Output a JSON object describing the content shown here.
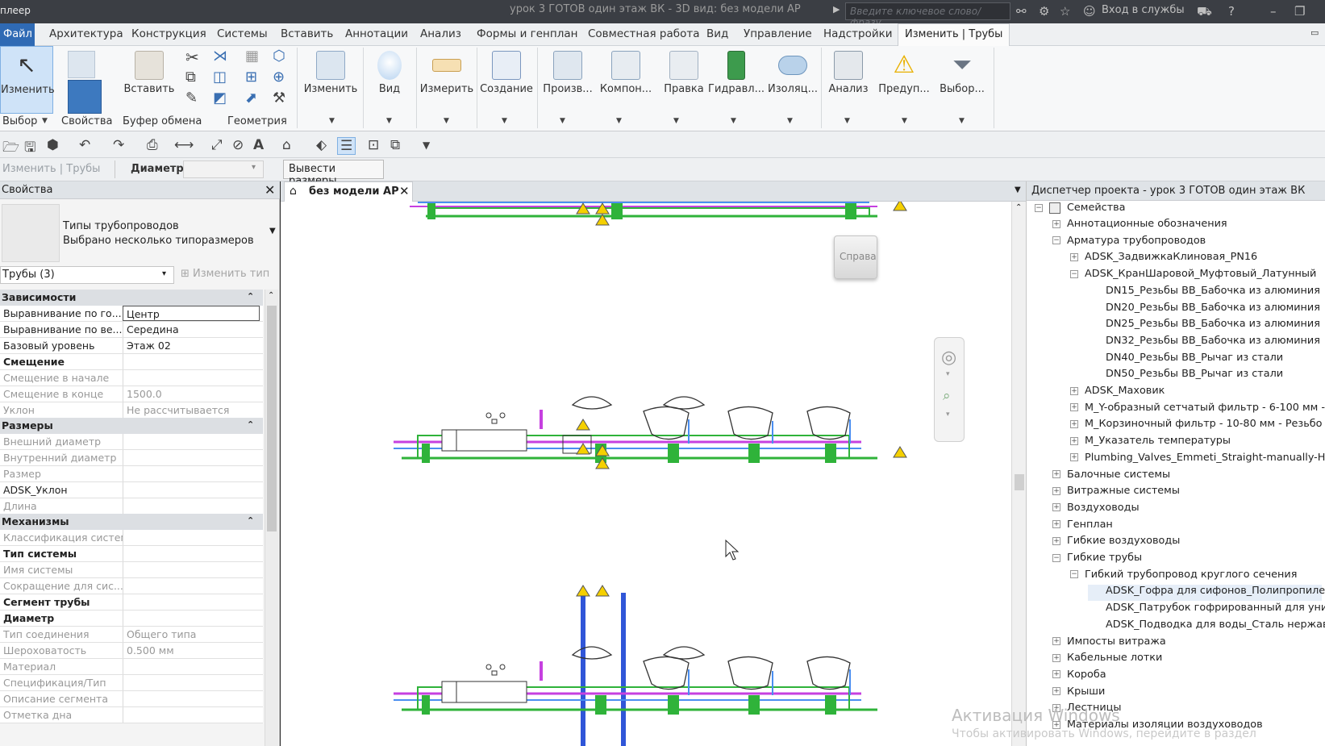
{
  "titlebar": {
    "app": "плеер",
    "doc_title": "урок 3 ГОТОВ один этаж ВК - 3D вид: без модели АР",
    "search_placeholder": "Введите ключевое слово/фразу",
    "signin": "Вход в службы"
  },
  "menu": {
    "file": "Файл",
    "tabs": [
      "Архитектура",
      "Конструкция",
      "Системы",
      "Вставить",
      "Аннотации",
      "Анализ",
      "Формы и генплан",
      "Совместная работа",
      "Вид",
      "Управление",
      "Надстройки"
    ],
    "active_tab": "Изменить | Трубы"
  },
  "ribbon": {
    "modify": "Изменить",
    "paste": "Вставить",
    "modify2": "Изменить",
    "view": "Вид",
    "measure": "Измерить",
    "create": "Создание",
    "produce": "Произв...",
    "components": "Компон...",
    "edit": "Правка",
    "hydraulic": "Гидравл...",
    "insulation": "Изоляц...",
    "analysis": "Анализ",
    "warnings": "Предуп...",
    "filter": "Выбор...",
    "groups": {
      "select": "Выбор",
      "properties": "Свойства",
      "clipboard": "Буфер обмена",
      "geometry": "Геометрия"
    }
  },
  "optionsbar": {
    "context": "Изменить | Трубы",
    "diameter_label": "Диаметр:",
    "show_dims": "Вывести размеры"
  },
  "properties": {
    "title": "Свойства",
    "type_line1": "Типы трубопроводов",
    "type_line2": "Выбрано несколько типоразмеров",
    "selector": "Трубы (3)",
    "edit_type": "Изменить тип",
    "cat_constraints": "Зависимости",
    "cat_dimensions": "Размеры",
    "cat_mechanical": "Механизмы",
    "rows_a": [
      {
        "k": "Выравнивание по го...",
        "v": "Центр"
      },
      {
        "k": "Выравнивание по ве...",
        "v": "Середина"
      },
      {
        "k": "Базовый уровень",
        "v": "Этаж 02"
      },
      {
        "k": "Смещение",
        "v": ""
      },
      {
        "k": "Смещение в начале",
        "v": ""
      },
      {
        "k": "Смещение в конце",
        "v": "1500.0"
      },
      {
        "k": "Уклон",
        "v": "Не рассчитывается"
      }
    ],
    "rows_b": [
      {
        "k": "Внешний диаметр",
        "v": ""
      },
      {
        "k": "Внутренний диаметр",
        "v": ""
      },
      {
        "k": "Размер",
        "v": ""
      },
      {
        "k": "ADSK_Уклон",
        "v": ""
      },
      {
        "k": "Длина",
        "v": ""
      }
    ],
    "rows_c": [
      {
        "k": "Классификация систем",
        "v": ""
      },
      {
        "k": "Тип системы",
        "v": ""
      },
      {
        "k": "Имя системы",
        "v": ""
      },
      {
        "k": "Сокращение для сис...",
        "v": ""
      },
      {
        "k": "Сегмент трубы",
        "v": ""
      },
      {
        "k": "Диаметр",
        "v": ""
      },
      {
        "k": "Тип соединения",
        "v": "Общего типа"
      },
      {
        "k": "Шероховатость",
        "v": "0.500 мм"
      },
      {
        "k": "Материал",
        "v": ""
      },
      {
        "k": "Спецификация/Тип",
        "v": ""
      },
      {
        "k": "Описание сегмента",
        "v": ""
      },
      {
        "k": "Отметка дна",
        "v": ""
      }
    ]
  },
  "view": {
    "tab_label": "без модели АР",
    "viewcube_label": "Справа"
  },
  "browser": {
    "title": "Диспетчер проекта - урок 3 ГОТОВ один этаж ВК",
    "root": "Семейства",
    "items": [
      {
        "label": "Аннотационные обозначения",
        "lvl": 1,
        "tg": "+"
      },
      {
        "label": "Арматура трубопроводов",
        "lvl": 1,
        "tg": "−"
      },
      {
        "label": "ADSK_ЗадвижкаКлиновая_PN16",
        "lvl": 2,
        "tg": "+"
      },
      {
        "label": "ADSK_КранШаровой_Муфтовый_Латунный",
        "lvl": 2,
        "tg": "−"
      },
      {
        "label": "DN15_Резьбы ВВ_Бабочка из алюминия",
        "lvl": 3,
        "tg": ""
      },
      {
        "label": "DN20_Резьбы ВВ_Бабочка из алюминия",
        "lvl": 3,
        "tg": ""
      },
      {
        "label": "DN25_Резьбы ВВ_Бабочка из алюминия",
        "lvl": 3,
        "tg": ""
      },
      {
        "label": "DN32_Резьбы ВВ_Бабочка из алюминия",
        "lvl": 3,
        "tg": ""
      },
      {
        "label": "DN40_Резьбы ВВ_Рычаг из стали",
        "lvl": 3,
        "tg": ""
      },
      {
        "label": "DN50_Резьбы ВВ_Рычаг из стали",
        "lvl": 3,
        "tg": ""
      },
      {
        "label": "ADSK_Маховик",
        "lvl": 2,
        "tg": "+"
      },
      {
        "label": "M_Y-образный сетчатый фильтр - 6-100 мм - ",
        "lvl": 2,
        "tg": "+"
      },
      {
        "label": "M_Корзиночный фильтр - 10-80 мм - Резьбо",
        "lvl": 2,
        "tg": "+"
      },
      {
        "label": "M_Указатель температуры",
        "lvl": 2,
        "tg": "+"
      },
      {
        "label": "Plumbing_Valves_Emmeti_Straight-manually-H.",
        "lvl": 2,
        "tg": "+"
      },
      {
        "label": "Балочные системы",
        "lvl": 1,
        "tg": "+"
      },
      {
        "label": "Витражные системы",
        "lvl": 1,
        "tg": "+"
      },
      {
        "label": "Воздуховоды",
        "lvl": 1,
        "tg": "+"
      },
      {
        "label": "Генплан",
        "lvl": 1,
        "tg": "+"
      },
      {
        "label": "Гибкие воздуховоды",
        "lvl": 1,
        "tg": "+"
      },
      {
        "label": "Гибкие трубы",
        "lvl": 1,
        "tg": "−"
      },
      {
        "label": "Гибкий трубопровод круглого сечения",
        "lvl": 2,
        "tg": "−"
      },
      {
        "label": "ADSK_Гофра для сифонов_Полипропилен",
        "lvl": 3,
        "tg": ""
      },
      {
        "label": "ADSK_Патрубок гофрированный для унит",
        "lvl": 3,
        "tg": ""
      },
      {
        "label": "ADSK_Подводка для воды_Сталь нержаве",
        "lvl": 3,
        "tg": ""
      },
      {
        "label": "Импосты витража",
        "lvl": 1,
        "tg": "+"
      },
      {
        "label": "Кабельные лотки",
        "lvl": 1,
        "tg": "+"
      },
      {
        "label": "Короба",
        "lvl": 1,
        "tg": "+"
      },
      {
        "label": "Крыши",
        "lvl": 1,
        "tg": "+"
      },
      {
        "label": "Лестницы",
        "lvl": 1,
        "tg": "+"
      },
      {
        "label": "Материалы изоляции воздуховодов",
        "lvl": 1,
        "tg": "+"
      }
    ]
  },
  "watermark": {
    "line1": "Активация Windows",
    "line2": "Чтобы активировать Windows, перейдите в раздел"
  }
}
